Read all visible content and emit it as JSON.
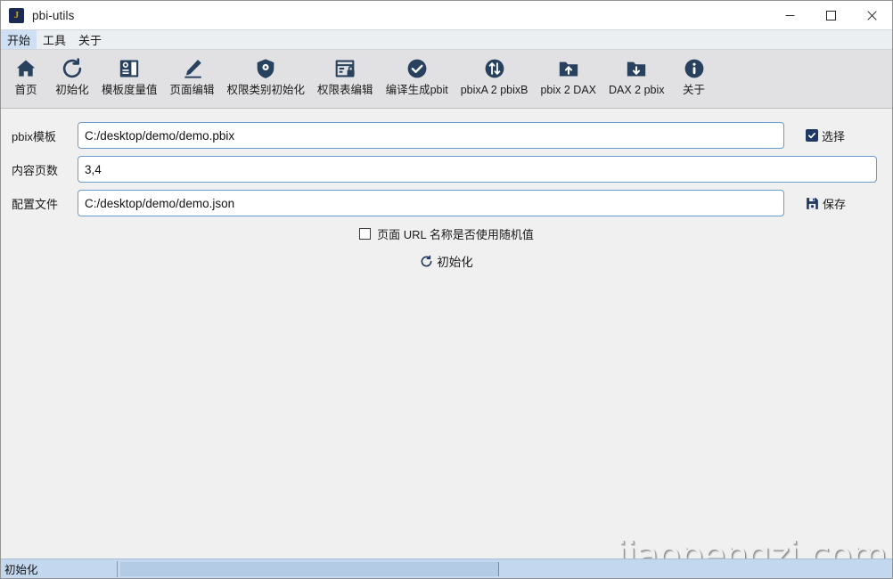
{
  "window": {
    "title": "pbi-utils",
    "icon_letter": "J",
    "icon_name": "app-icon-j",
    "controls": [
      {
        "name": "minimize-button",
        "glyph": "minimize"
      },
      {
        "name": "maximize-button",
        "glyph": "maximize"
      },
      {
        "name": "close-button",
        "glyph": "close"
      }
    ]
  },
  "menubar": {
    "items": [
      {
        "label": "开始",
        "active": true
      },
      {
        "label": "工具",
        "active": false
      },
      {
        "label": "关于",
        "active": false
      }
    ]
  },
  "toolbar": {
    "items": [
      {
        "label": "首页",
        "icon": "home-icon"
      },
      {
        "label": "初始化",
        "icon": "reset-icon"
      },
      {
        "label": "模板度量值",
        "icon": "template-panel-icon"
      },
      {
        "label": "页面编辑",
        "icon": "pencil-icon"
      },
      {
        "label": "权限类别初始化",
        "icon": "shield-gear-icon"
      },
      {
        "label": "权限表编辑",
        "icon": "table-lock-icon"
      },
      {
        "label": "编译生成pbit",
        "icon": "check-circle-icon"
      },
      {
        "label": "pbixA 2 pbixB",
        "icon": "swap-arrows-circle-icon"
      },
      {
        "label": "pbix 2 DAX",
        "icon": "folder-upload-icon"
      },
      {
        "label": "DAX 2 pbix",
        "icon": "folder-download-icon"
      },
      {
        "label": "关于",
        "icon": "info-circle-icon"
      }
    ]
  },
  "form": {
    "rows": [
      {
        "label": "pbix模板",
        "value": "C:/desktop/demo/demo.pbix",
        "placeholder": "",
        "side": {
          "type": "checkbox",
          "label": "选择",
          "checked": true
        }
      },
      {
        "label": "内容页数",
        "value": "3,4",
        "placeholder": "",
        "side": null
      },
      {
        "label": "配置文件",
        "value": "C:/desktop/demo/demo.json",
        "placeholder": "",
        "side": {
          "type": "save",
          "label": "保存",
          "checked": false
        }
      }
    ],
    "random_url_checkbox": {
      "label": "页面 URL 名称是否使用随机值",
      "checked": false
    },
    "init_button": {
      "label": "初始化",
      "icon": "reset-icon"
    }
  },
  "statusbar": {
    "text": "初始化",
    "progress_percent": 0
  },
  "watermark": {
    "text": "jiaopengzi.com"
  },
  "colors": {
    "accent": "#1f3864",
    "icon": "#28415e",
    "menu_active": "#cfe0f5",
    "toolbar_bg": "#e1e1e3",
    "body_bg": "#f0f0f0",
    "input_border": "#6b9ccd",
    "statusbar_bg": "#c3d7ee",
    "title_icon_bg": "#1b2a52",
    "title_icon_fg": "#d2a010"
  }
}
